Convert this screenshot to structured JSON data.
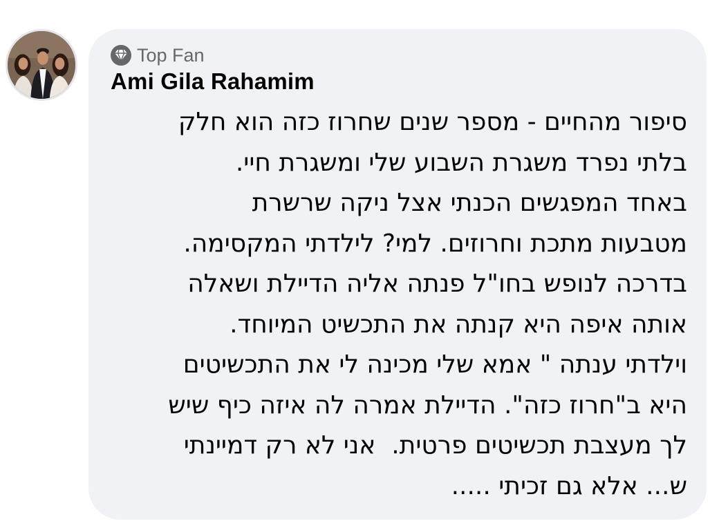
{
  "comment": {
    "badge_label": "Top Fan",
    "badge_icon": "diamond-icon",
    "author_name": "Ami Gila Rahamim",
    "lines": [
      "סיפור מהחיים - מספר שנים שחרוז כזה הוא חלק",
      "בלתי נפרד משגרת השבוע שלי ומשגרת חיי.",
      "באחד המפגשים הכנתי אצל ניקה שרשרת",
      "מטבעות מתכת וחרוזים. למי? לילדתי המקסימה.",
      "בדרכה לנופש בחו\"ל פנתה אליה הדיילת ושאלה",
      "אותה איפה היא קנתה את התכשיט המיוחד.",
      "וילדתי ענתה \" אמא שלי מכינה לי את התכשיטים",
      "היא ב\"חרוז כזה\". הדיילת אמרה לה איזה כיף שיש",
      "לך מעצבת תכשיטים פרטית.  אני לא רק דמיינתי",
      "ש... אלא גם זכיתי ....."
    ]
  },
  "colors": {
    "bubble_background": "#f0f2f5",
    "secondary_text": "#65676b",
    "primary_text": "#050505",
    "avatar_border": "#e4e6eb"
  }
}
